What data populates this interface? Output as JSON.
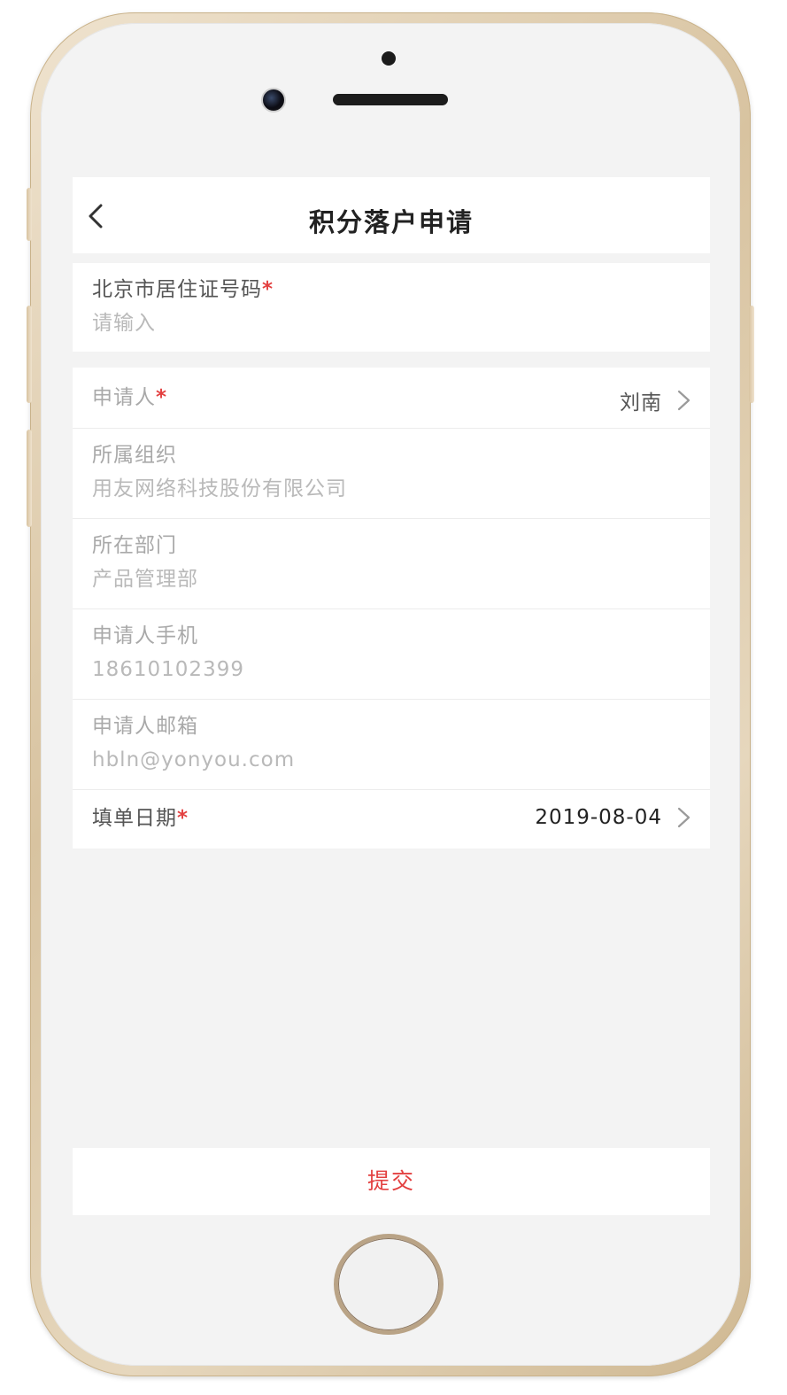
{
  "header": {
    "title": "积分落户申请"
  },
  "form": {
    "residence_permit": {
      "label": "北京市居住证号码",
      "required_mark": "*",
      "placeholder": "请输入"
    },
    "applicant": {
      "label": "申请人",
      "required_mark": "*",
      "value": "刘南"
    },
    "organization": {
      "label": "所属组织",
      "value": "用友网络科技股份有限公司"
    },
    "department": {
      "label": "所在部门",
      "value": "产品管理部"
    },
    "phone": {
      "label": "申请人手机",
      "value": "18610102399"
    },
    "email": {
      "label": "申请人邮箱",
      "value": "hbln@yonyou.com"
    },
    "fill_date": {
      "label": "填单日期",
      "required_mark": "*",
      "value": "2019-08-04"
    }
  },
  "footer": {
    "submit_label": "提交"
  },
  "colors": {
    "accent_red": "#e34040",
    "background": "#f3f3f3"
  },
  "icons": {
    "back": "chevron-left-icon",
    "row_arrow": "chevron-right-icon"
  }
}
